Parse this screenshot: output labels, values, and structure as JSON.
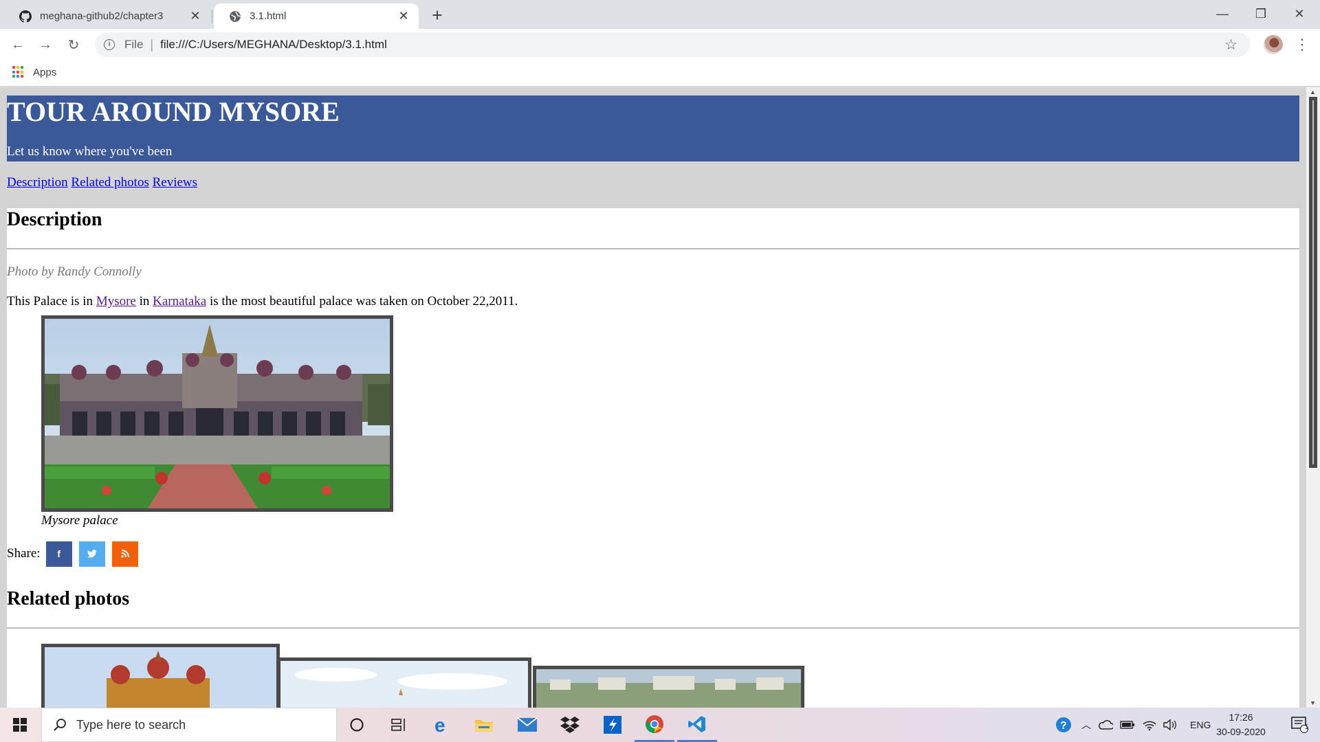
{
  "browser": {
    "tabs": [
      {
        "title": "meghana-github2/chapter3",
        "active": false,
        "icon": "github-icon"
      },
      {
        "title": "3.1.html",
        "active": true,
        "icon": "globe-icon"
      }
    ],
    "address": {
      "scheme_label": "File",
      "url": "file:///C:/Users/MEGHANA/Desktop/3.1.html"
    },
    "bookmarks": {
      "apps_label": "Apps"
    }
  },
  "page": {
    "header": {
      "title": "TOUR AROUND MYSORE",
      "tagline": "Let us know where you've been"
    },
    "nav": {
      "description": "Description",
      "related": "Related photos",
      "reviews": "Reviews"
    },
    "description": {
      "heading": "Description",
      "credit": "Photo by Randy Connolly",
      "text_before": "This Palace is in ",
      "link_mysore": "Mysore",
      "text_mid": " in ",
      "link_karnataka": "Karnataka",
      "text_after": " is the most beautiful palace was taken on October 22,2011.",
      "figure_caption": "Mysore palace"
    },
    "share": {
      "label": "Share:",
      "buttons": [
        {
          "name": "facebook",
          "glyph": "f",
          "color": "#3b5998"
        },
        {
          "name": "twitter",
          "glyph": "t",
          "color": "#55acee"
        },
        {
          "name": "rss",
          "glyph": "rss",
          "color": "#f26109"
        }
      ]
    },
    "related": {
      "heading": "Related photos"
    },
    "colors": {
      "header_bg": "#3b5998",
      "page_bg": "#d4d4d4",
      "link": "#0000ee",
      "visited_link": "#551a8b"
    }
  },
  "taskbar": {
    "search_placeholder": "Type here to search",
    "language": "ENG",
    "time": "17:26",
    "date": "30-09-2020",
    "notification_count": "1"
  }
}
